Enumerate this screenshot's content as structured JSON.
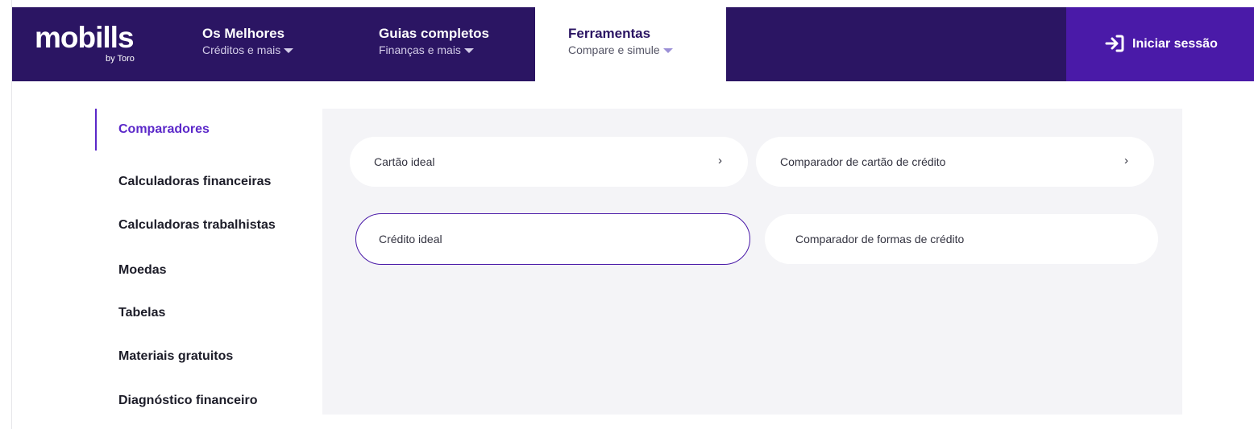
{
  "header": {
    "logo": {
      "main": "mobills",
      "sub": "by Toro"
    },
    "nav": [
      {
        "title": "Os Melhores",
        "subtitle": "Créditos e mais"
      },
      {
        "title": "Guias completos",
        "subtitle": "Finanças e mais"
      },
      {
        "title": "Ferramentas",
        "subtitle": "Compare e simule"
      }
    ],
    "login_label": "Iniciar sessão"
  },
  "sidebar": {
    "items": [
      {
        "label": "Comparadores"
      },
      {
        "label": "Calculadoras financeiras"
      },
      {
        "label": "Calculadoras trabalhistas"
      },
      {
        "label": "Moedas"
      },
      {
        "label": "Tabelas"
      },
      {
        "label": "Materiais gratuitos"
      },
      {
        "label": "Diagnóstico financeiro"
      }
    ]
  },
  "tools": [
    {
      "label": "Cartão ideal",
      "chevron": "›"
    },
    {
      "label": "Comparador de cartão de crédito",
      "chevron": "›"
    },
    {
      "label": "Crédito ideal"
    },
    {
      "label": "Comparador de formas de crédito"
    }
  ],
  "colors": {
    "nav_bg": "#2b1563",
    "login_bg": "#4a1aa8",
    "accent": "#5b28c9",
    "panel_bg": "#f4f4f7"
  }
}
